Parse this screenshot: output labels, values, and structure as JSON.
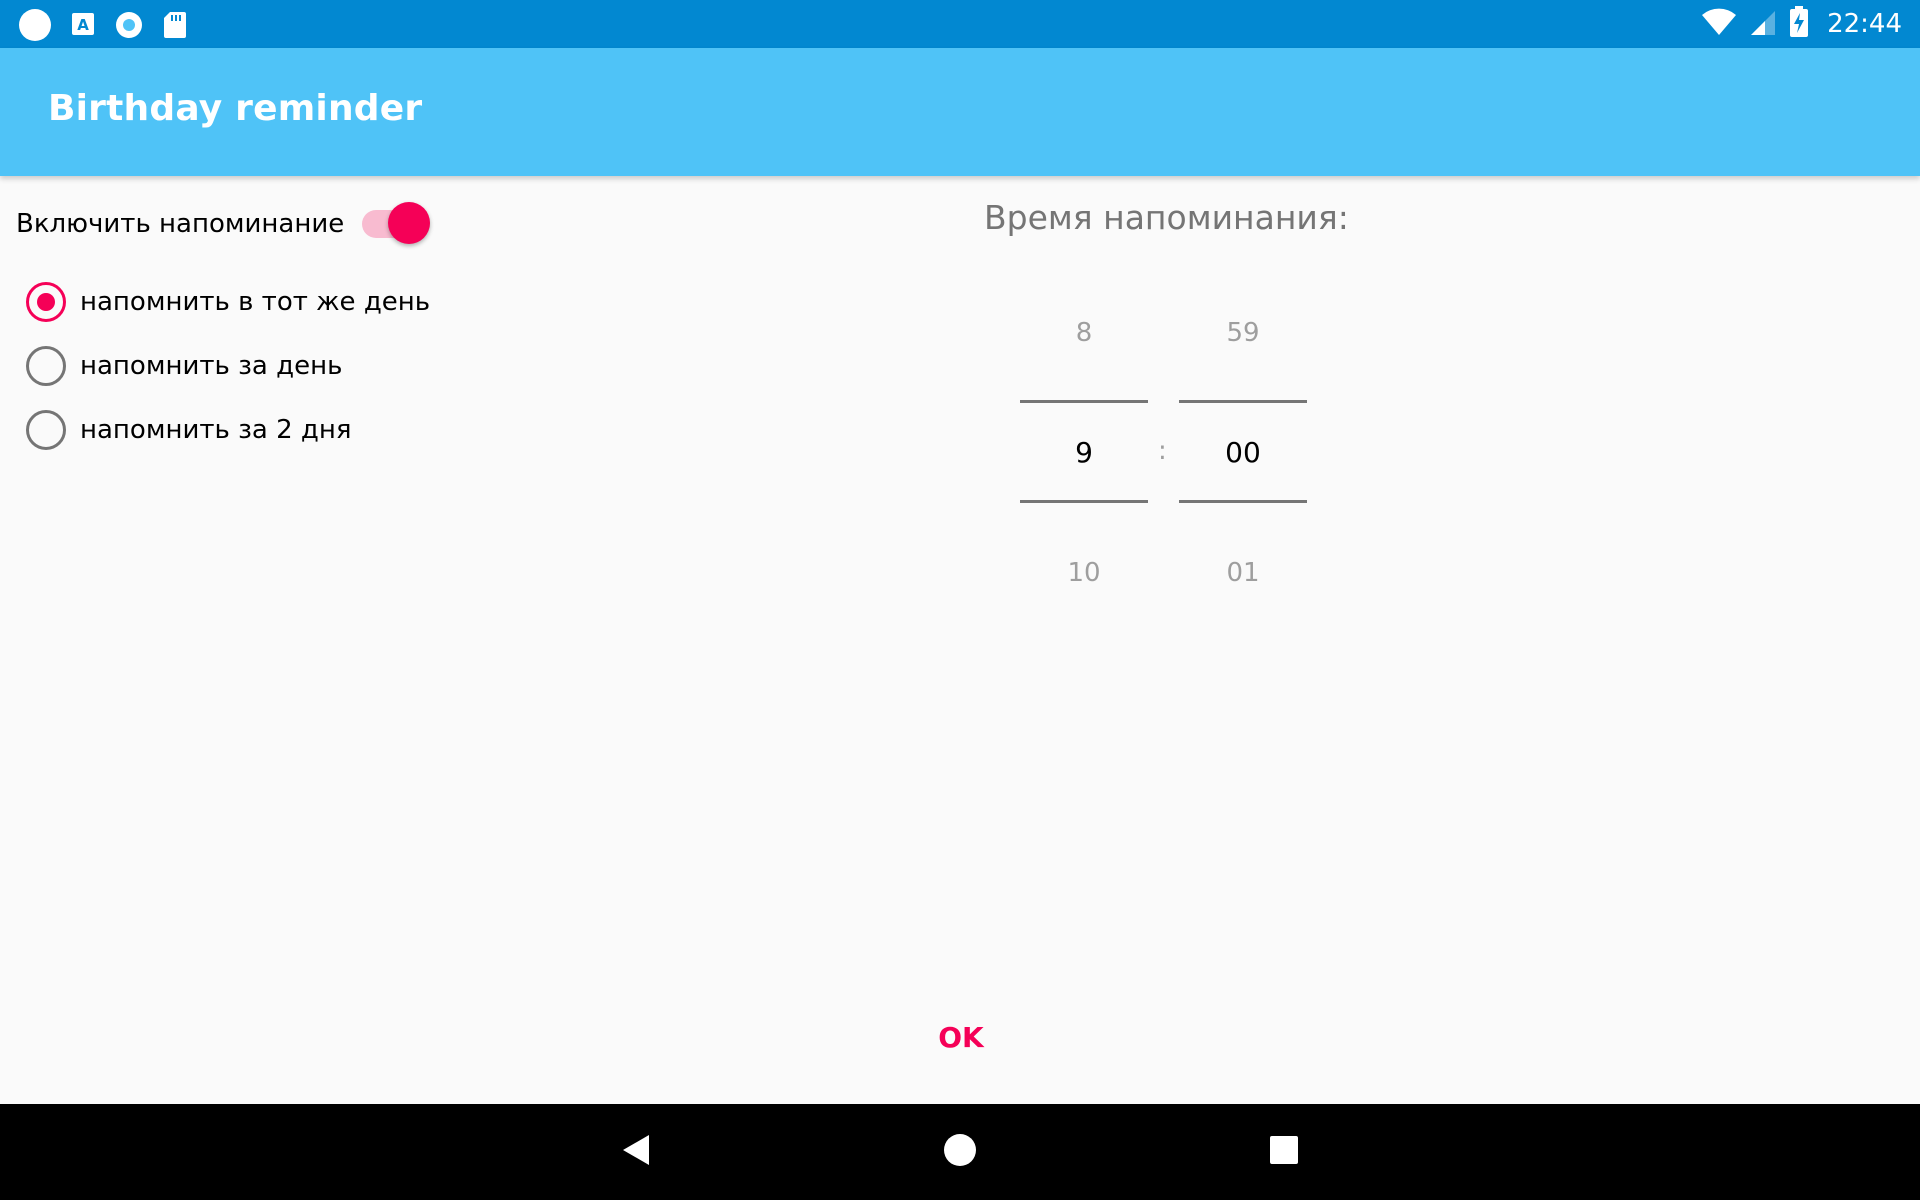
{
  "status_bar": {
    "time": "22:44",
    "left_icons": [
      "circle-icon",
      "app-a-icon",
      "radio-icon",
      "sd-card-icon"
    ],
    "right_icons": [
      "wifi-icon",
      "signal-icon",
      "battery-charging-icon"
    ]
  },
  "app_bar": {
    "title": "Birthday reminder",
    "color": "#4fc3f7"
  },
  "reminder": {
    "toggle_label": "Включить напоминание",
    "toggle_on": true,
    "options": [
      {
        "label": "напомнить в тот же день",
        "checked": true
      },
      {
        "label": "напомнить за день",
        "checked": false
      },
      {
        "label": "напомнить за 2 дня",
        "checked": false
      }
    ]
  },
  "time_picker": {
    "heading": "Время напоминания:",
    "hours": {
      "prev": "8",
      "current": "9",
      "next": "10"
    },
    "separator": ":",
    "minutes": {
      "prev": "59",
      "current": "00",
      "next": "01"
    }
  },
  "actions": {
    "ok_label": "OK"
  },
  "colors": {
    "accent": "#f50057",
    "status_bar": "#0288d1"
  },
  "nav_bar": {
    "buttons": [
      "back-icon",
      "home-icon",
      "recents-icon"
    ]
  }
}
